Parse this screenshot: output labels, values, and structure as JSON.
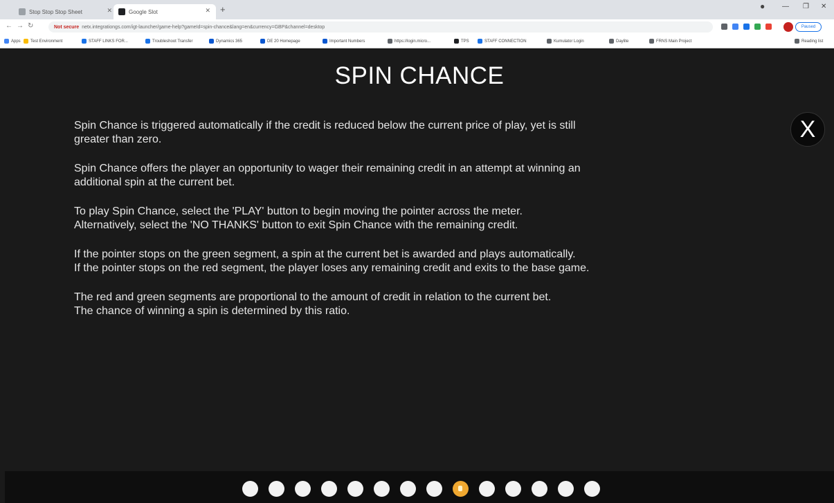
{
  "browser": {
    "tabs": [
      {
        "label": "Stop Stop Stop Sheet"
      },
      {
        "label": "Google Slot"
      }
    ],
    "new_tab": "+",
    "address": {
      "warning": "Not secure",
      "url": "netx.integrationgs.com/igt-launcher/game-help?gameId=spin-chance&lang=en&currency=GBP&channel=desktop"
    },
    "paused_label": "Paused",
    "bookmarks": [
      {
        "label": "Apps"
      },
      {
        "label": "Test Environment"
      },
      {
        "label": "STAFF LINKS FOR..."
      },
      {
        "label": "Troubleshoot Transfer"
      },
      {
        "label": "Dynamics 365"
      },
      {
        "label": "DE 20 Homepage"
      },
      {
        "label": "Important Numbers"
      },
      {
        "label": "https://login.micro..."
      },
      {
        "label": "TPS"
      },
      {
        "label": "STAFF CONNECTION"
      },
      {
        "label": "Kumulator Login"
      },
      {
        "label": "Daylite"
      },
      {
        "label": "FRNS Main Project"
      }
    ],
    "reading_list": "Reading list"
  },
  "game": {
    "title": "SPIN CHANCE",
    "close_label": "X",
    "paragraphs": [
      [
        "Spin Chance is triggered automatically if the credit is reduced below the current price of play, yet is still",
        "greater than zero."
      ],
      [
        "Spin Chance offers the player an opportunity to wager their remaining credit in an attempt at winning an",
        "additional spin at the current bet."
      ],
      [
        "To play Spin Chance, select the 'PLAY' button to begin moving the pointer across the meter.",
        "Alternatively, select the 'NO THANKS' button to exit Spin Chance with the remaining credit."
      ],
      [
        "If the pointer stops on the green segment, a spin at the current bet is awarded and plays automatically.",
        "If the pointer stops on the red segment, the player loses any remaining credit and exits to the base game."
      ],
      [
        "The red and green segments are proportional to the amount of credit in relation to the current bet.",
        "The chance of winning a spin is determined by this ratio."
      ]
    ],
    "pager": {
      "total": 14,
      "current": 9,
      "active_color": "#f0a830"
    }
  }
}
